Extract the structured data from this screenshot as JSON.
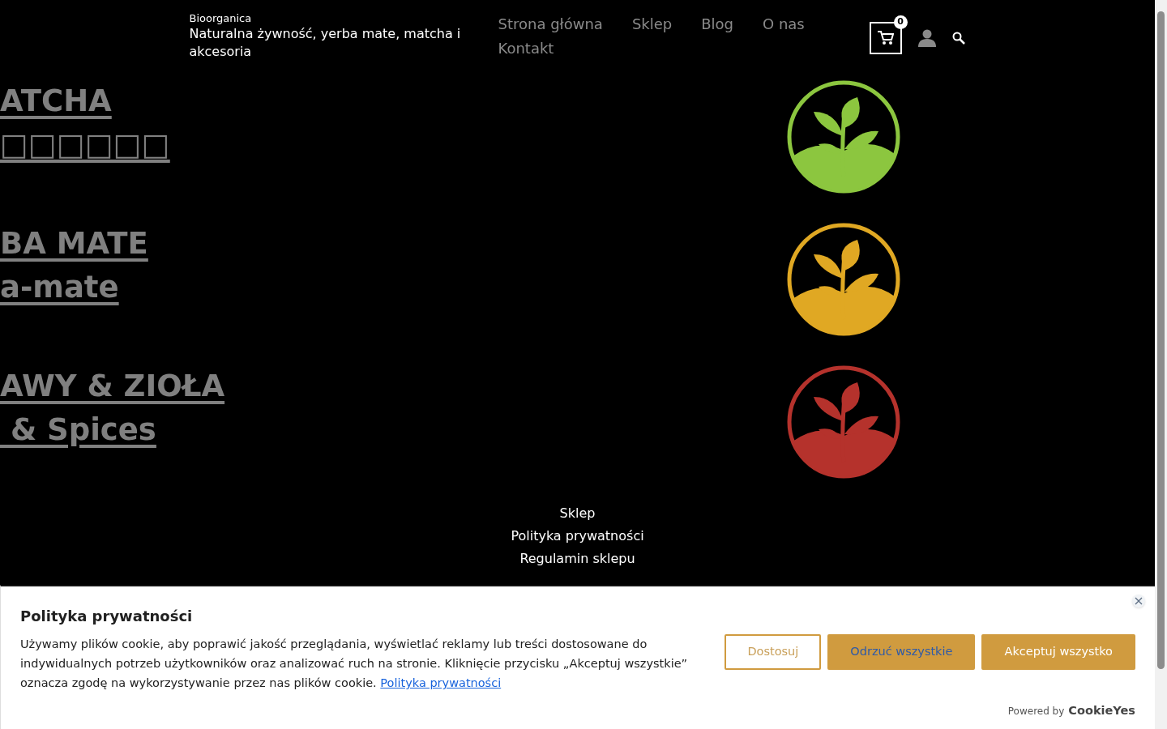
{
  "header": {
    "site_name": "Bioorganica",
    "tagline": "Naturalna żywność, yerba mate, matcha i akcesoria",
    "nav": [
      "Strona główna",
      "Sklep",
      "Blog",
      "O nas",
      "Kontakt"
    ],
    "cart_count": "0"
  },
  "categories": [
    {
      "title": "ATCHA",
      "subtitle": "□□□□□□",
      "color": "#8cc63f"
    },
    {
      "title": "BA MATE",
      "subtitle": "a-mate",
      "color": "#e0a823"
    },
    {
      "title": "AWY & ZIOŁA",
      "subtitle": " & Spices",
      "color": "#b5322c"
    }
  ],
  "footer_links": [
    "Sklep",
    "Polityka prywatności",
    "Regulamin sklepu"
  ],
  "cookie_banner": {
    "title": "Polityka prywatności",
    "text": "Używamy plików cookie, aby poprawić jakość przeglądania, wyświetlać reklamy lub treści dostosowane do indywidualnych potrzeb użytkowników oraz analizować ruch na stronie. Kliknięcie przycisku „Akceptuj wszystkie” oznacza zgodę na wykorzystywanie przez nas plików cookie.",
    "link": "Polityka prywatności",
    "buttons": [
      {
        "label": "Dostosuj",
        "kind": "outline"
      },
      {
        "label": "Odrzuć wszystkie",
        "kind": "reject"
      },
      {
        "label": "Akceptuj wszystko",
        "kind": "accept"
      }
    ],
    "powered_by": "Powered by",
    "brand": "CookieYes"
  }
}
